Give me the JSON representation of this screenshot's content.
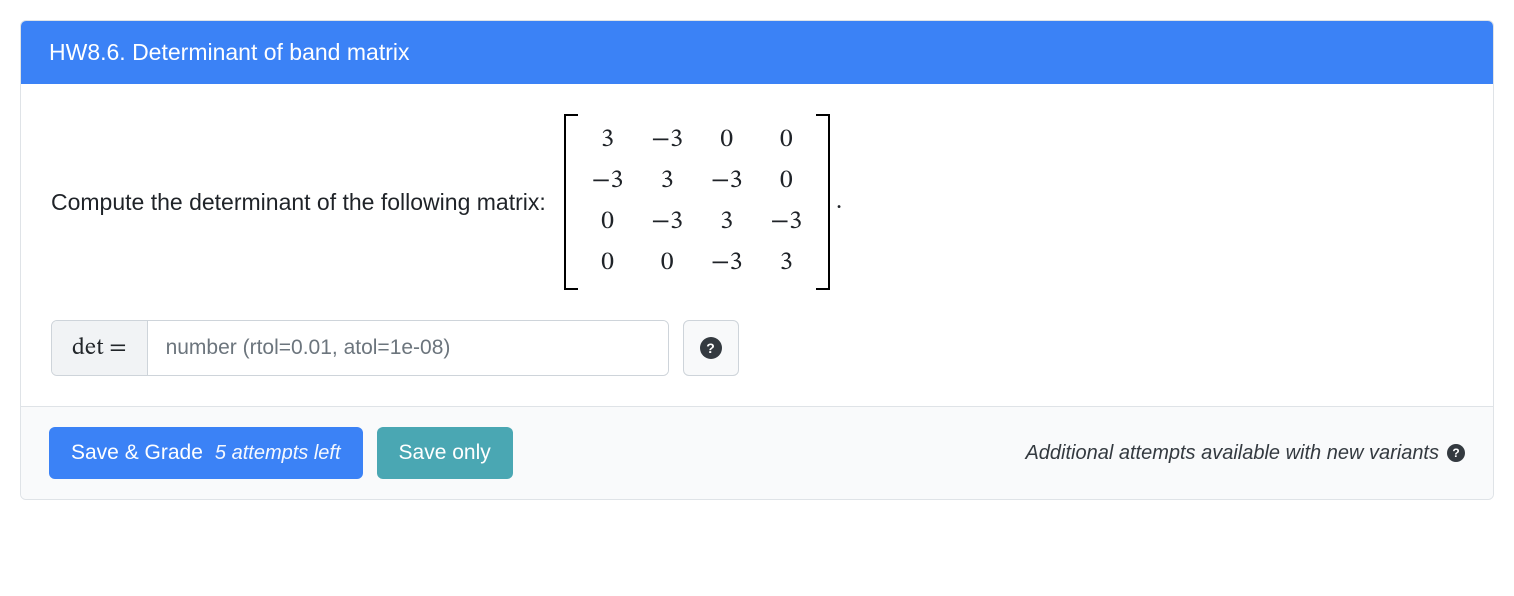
{
  "header": {
    "title": "HW8.6. Determinant of band matrix"
  },
  "prompt": {
    "text": "Compute the determinant of the following matrix:",
    "period": "."
  },
  "chart_data": {
    "type": "table",
    "title": "4×4 band matrix",
    "rows": [
      [
        "3",
        "−3",
        "0",
        "0"
      ],
      [
        "−3",
        "3",
        "−3",
        "0"
      ],
      [
        "0",
        "−3",
        "3",
        "−3"
      ],
      [
        "0",
        "0",
        "−3",
        "3"
      ]
    ]
  },
  "answer": {
    "label": "det =",
    "placeholder": "number (rtol=0.01, atol=1e-08)",
    "value": "",
    "help_symbol": "?"
  },
  "footer": {
    "save_grade_label": "Save & Grade",
    "attempts_text": "5 attempts left",
    "save_only_label": "Save only",
    "additional_text": "Additional attempts available with new variants",
    "info_symbol": "?"
  }
}
